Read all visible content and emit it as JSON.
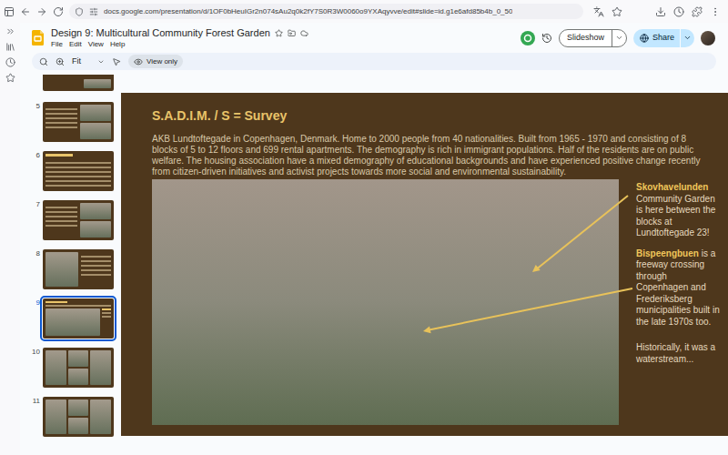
{
  "browser": {
    "address": "docs.google.com/presentation/d/1OF0bHeuIGr2n074sAu2q0k2fY7S0R3W0060o9YXAqyvve/edit#slide=id.g1e6afd85b4b_0_50"
  },
  "document": {
    "title": "Design 9: Multicultural Community Forest Garden",
    "menus": [
      "File",
      "Edit",
      "View",
      "Help"
    ],
    "buttons": {
      "slideshow": "Slideshow",
      "share": "Share"
    }
  },
  "toolbar": {
    "zoom": "Fit",
    "mode": "View only"
  },
  "filmstrip": [
    {
      "number": "5",
      "selected": false,
      "kind": "text-photo"
    },
    {
      "number": "6",
      "selected": false,
      "kind": "text"
    },
    {
      "number": "7",
      "selected": false,
      "kind": "text-photo"
    },
    {
      "number": "8",
      "selected": false,
      "kind": "photo-text"
    },
    {
      "number": "9",
      "selected": true,
      "kind": "title-photo"
    },
    {
      "number": "10",
      "selected": false,
      "kind": "photos"
    },
    {
      "number": "11",
      "selected": false,
      "kind": "photos"
    }
  ],
  "slide": {
    "title": "S.A.D.I.M. / S = Survey",
    "body": "AKB Lundtoftegade in Copenhagen, Denmark. Home to 2000 people from 40 nationalities. Built from 1965 - 1970 and consisting of 8 blocks of 5 to 12 floors and 699 rental apartments. The demography is rich in immigrant populations. Half of the residents are on public welfare. The housing association have a mixed demography of educational backgrounds and have experienced positive change recently from citizen-driven initiatives and activist projects towards more social and environmental sustainability.",
    "annotations": [
      {
        "heading": "Skovhavelunden",
        "text": " Community Garden is here between the blocks at Lundtoftegade 23!"
      },
      {
        "heading": "Bispeengbuen",
        "text": " is a freeway crossing through Copenhagen and Frederiksberg municipalities built in the late 1970s too."
      }
    ],
    "note": "Historically, it was a waterstream..."
  }
}
